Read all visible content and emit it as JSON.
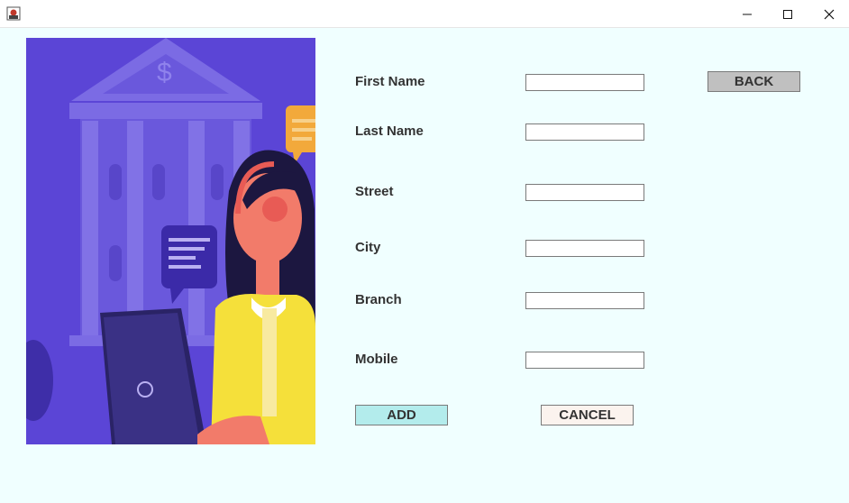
{
  "window": {
    "icon": "java-app-icon",
    "controls": [
      "minimize-icon",
      "maximize-icon",
      "close-icon"
    ]
  },
  "form": {
    "fields": [
      {
        "label": "First Name",
        "value": ""
      },
      {
        "label": "Last Name",
        "value": ""
      },
      {
        "label": "Street",
        "value": ""
      },
      {
        "label": "City",
        "value": ""
      },
      {
        "label": "Branch",
        "value": ""
      },
      {
        "label": "Mobile",
        "value": ""
      }
    ]
  },
  "buttons": {
    "back": "BACK",
    "add": "ADD",
    "cancel": "CANCEL"
  },
  "colors": {
    "background": "#f0ffff",
    "add_button": "#b3ecec",
    "cancel_button": "#fbf3ee",
    "back_button": "#c0c0c0",
    "illustration_bg": "#5b45d6"
  }
}
